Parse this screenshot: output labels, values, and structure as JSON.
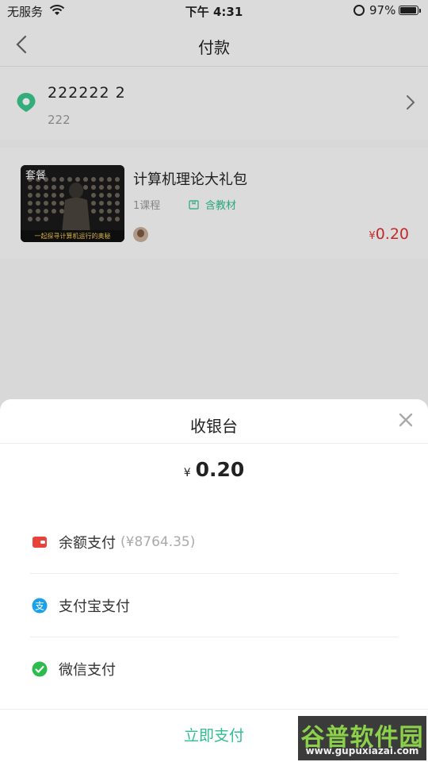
{
  "status_bar": {
    "carrier": "无服务",
    "time": "下午 4:31",
    "battery_percent": "97%",
    "battery_level": 0.97
  },
  "nav": {
    "title": "付款"
  },
  "address": {
    "name": "222222  2",
    "detail": "222"
  },
  "course": {
    "thumb_tag": "套餐",
    "thumb_caption": "一起探寻计算机运行的奥秘",
    "title": "计算机理论大礼包",
    "lessons": "1课程",
    "material": "含教材",
    "price_currency": "¥",
    "price_value": "0.20"
  },
  "cashier": {
    "title": "收银台",
    "amount_currency": "¥",
    "amount_value": "0.20",
    "options": [
      {
        "label": "余额支付",
        "balance": "(¥8764.35)",
        "icon": "wallet-icon",
        "color": "#e8433b"
      },
      {
        "label": "支付宝支付",
        "balance": "",
        "icon": "alipay-icon",
        "color": "#1aa1e8"
      },
      {
        "label": "微信支付",
        "balance": "",
        "icon": "wechat-pay-icon",
        "color": "#2dbb4e"
      }
    ],
    "pay_button": "立即支付"
  },
  "colors": {
    "accent_green": "#2fbf8f",
    "price_red": "#e02f2f"
  },
  "watermark": {
    "main": "谷普软件园",
    "url": "www.gupuxiazai.com"
  }
}
